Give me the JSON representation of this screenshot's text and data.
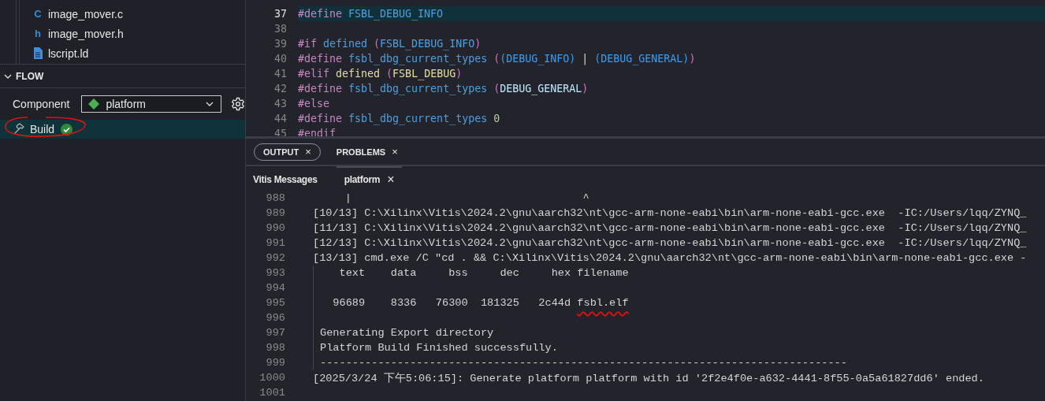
{
  "explorer": {
    "files": [
      {
        "badge": "C",
        "kind": "letter",
        "name": "image_mover.c"
      },
      {
        "badge": "h",
        "kind": "letter",
        "name": "image_mover.h"
      },
      {
        "kind": "document",
        "name": "lscript.ld"
      }
    ]
  },
  "flow": {
    "title": "FLOW",
    "expanded": true,
    "component_label": "Component",
    "component_value": "platform",
    "steps": [
      {
        "label": "Build",
        "selected": true,
        "succeeded": true,
        "annotated": true
      }
    ]
  },
  "editor": {
    "lines": [
      {
        "n": "37",
        "current": true,
        "tokens": [
          {
            "kind": "directive",
            "text": "#define "
          },
          {
            "kind": "macro",
            "text": "FSBL_DEBUG_INFO"
          }
        ]
      },
      {
        "n": "38",
        "current": false
      },
      {
        "n": "39",
        "current": false,
        "tokens": [
          {
            "kind": "directive",
            "text": "#if "
          },
          {
            "kind": "macro",
            "text": "defined "
          },
          {
            "kind": "paren",
            "text": "("
          },
          {
            "kind": "macro",
            "text": "FSBL_DEBUG_INFO"
          },
          {
            "kind": "paren",
            "text": ")"
          }
        ]
      },
      {
        "n": "40",
        "current": false,
        "tokens": [
          {
            "kind": "directive",
            "text": "#define "
          },
          {
            "kind": "macro",
            "text": "fsbl_dbg_current_types "
          },
          {
            "kind": "paren",
            "text": "("
          },
          {
            "kind": "paren2",
            "text": "(DEBUG_INFO)"
          },
          {
            "kind": "plain",
            "text": " | "
          },
          {
            "kind": "paren2",
            "text": "(DEBUG_GENERAL)"
          },
          {
            "kind": "paren",
            "text": ")"
          }
        ]
      },
      {
        "n": "41",
        "current": false,
        "tokens": [
          {
            "kind": "directive",
            "text": "#elif "
          },
          {
            "kind": "func",
            "text": "defined "
          },
          {
            "kind": "paren",
            "text": "("
          },
          {
            "kind": "func",
            "text": "FSBL_DEBUG"
          },
          {
            "kind": "paren",
            "text": ")"
          }
        ]
      },
      {
        "n": "42",
        "current": false,
        "tokens": [
          {
            "kind": "directive",
            "text": "#define "
          },
          {
            "kind": "macro",
            "text": "fsbl_dbg_current_types "
          },
          {
            "kind": "paren",
            "text": "("
          },
          {
            "kind": "variable",
            "text": "DEBUG_GENERAL"
          },
          {
            "kind": "paren",
            "text": ")"
          }
        ]
      },
      {
        "n": "43",
        "current": false,
        "tokens": [
          {
            "kind": "directive",
            "text": "#else"
          }
        ]
      },
      {
        "n": "44",
        "current": false,
        "tokens": [
          {
            "kind": "directive",
            "text": "#define "
          },
          {
            "kind": "macro",
            "text": "fsbl_dbg_current_types "
          },
          {
            "kind": "number",
            "text": "0"
          }
        ]
      },
      {
        "n": "45",
        "current": false,
        "tokens": [
          {
            "kind": "directive",
            "text": "#endif"
          }
        ]
      }
    ]
  },
  "panel": {
    "tabs": [
      {
        "label": "OUTPUT",
        "close": "×",
        "selected": true
      },
      {
        "label": "PROBLEMS",
        "close": "×",
        "selected": false
      }
    ],
    "subtabs": [
      {
        "label": "Vitis Messages",
        "selected": false
      },
      {
        "label": "platform",
        "close": "×",
        "selected": true
      }
    ],
    "lines": [
      {
        "n": "988",
        "guide": false,
        "text": "     |                                    ^"
      },
      {
        "n": "989",
        "guide": false,
        "text": "[10/13] C:\\Xilinx\\Vitis\\2024.2\\gnu\\aarch32\\nt\\gcc-arm-none-eabi\\bin\\arm-none-eabi-gcc.exe  -IC:/Users/lqq/ZYNQ_"
      },
      {
        "n": "990",
        "guide": false,
        "text": "[11/13] C:\\Xilinx\\Vitis\\2024.2\\gnu\\aarch32\\nt\\gcc-arm-none-eabi\\bin\\arm-none-eabi-gcc.exe  -IC:/Users/lqq/ZYNQ_"
      },
      {
        "n": "991",
        "guide": false,
        "text": "[12/13] C:\\Xilinx\\Vitis\\2024.2\\gnu\\aarch32\\nt\\gcc-arm-none-eabi\\bin\\arm-none-eabi-gcc.exe  -IC:/Users/lqq/ZYNQ_"
      },
      {
        "n": "992",
        "guide": false,
        "text": "[13/13] cmd.exe /C \"cd . && C:\\Xilinx\\Vitis\\2024.2\\gnu\\aarch32\\nt\\gcc-arm-none-eabi\\bin\\arm-none-eabi-gcc.exe -"
      },
      {
        "n": "993",
        "guide": true,
        "text": "   text    data     bss     dec     hex filename"
      },
      {
        "n": "994",
        "guide": true
      },
      {
        "n": "995",
        "guide": true,
        "text": "  96689    8336   76300  181325   2c44d ",
        "marked": "fsbl.elf"
      },
      {
        "n": "996",
        "guide": true
      },
      {
        "n": "997",
        "guide": true,
        "text": "Generating Export directory"
      },
      {
        "n": "998",
        "guide": true,
        "text": "Platform Build Finished successfully."
      },
      {
        "n": "999",
        "guide": true,
        "text": "----------------------------------------------------------------------------------"
      },
      {
        "n": "1000",
        "guide": false,
        "text": "[2025/3/24 下午5:06:15]: Generate platform platform with id '2f2e4f0e-a632-4441-8f55-0a5a61827dd6' ended."
      },
      {
        "n": "1001",
        "guide": false
      }
    ]
  }
}
